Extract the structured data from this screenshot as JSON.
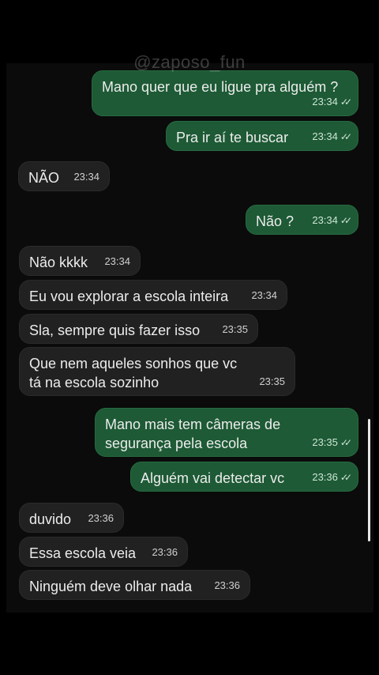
{
  "watermark": "@zaposo_fun",
  "messages": [
    {
      "dir": "out",
      "text": "Mano quer que eu ligue pra alguém ?",
      "time": "23:34",
      "read": "double-check-icon"
    },
    {
      "dir": "out",
      "text": "Pra ir aí te buscar",
      "time": "23:34",
      "read": "double-check-icon"
    },
    {
      "dir": "in",
      "text": "NÃO",
      "time": "23:34"
    },
    {
      "dir": "out",
      "text": "Não ?",
      "time": "23:34",
      "read": "double-check-icon"
    },
    {
      "dir": "in",
      "text": "Não kkkk",
      "time": "23:34"
    },
    {
      "dir": "in",
      "text": "Eu vou explorar a escola inteira",
      "time": "23:34"
    },
    {
      "dir": "in",
      "text": "Sla, sempre quis fazer isso",
      "time": "23:35"
    },
    {
      "dir": "in",
      "text": "Que nem aqueles sonhos que vc tá na escola sozinho",
      "time": "23:35"
    },
    {
      "dir": "out",
      "text": "Mano mais tem câmeras de segurança pela escola",
      "time": "23:35",
      "read": "double-check-icon"
    },
    {
      "dir": "out",
      "text": "Alguém vai detectar vc",
      "time": "23:36",
      "read": "double-check-icon"
    },
    {
      "dir": "in",
      "text": "duvido",
      "time": "23:36"
    },
    {
      "dir": "in",
      "text": "Essa escola veia",
      "time": "23:36"
    },
    {
      "dir": "in",
      "text": "Ninguém deve olhar nada",
      "time": "23:36"
    }
  ],
  "colors": {
    "outgoing_bubble": "#1d5a35",
    "incoming_bubble": "#212121",
    "background": "#0b0b0b"
  }
}
